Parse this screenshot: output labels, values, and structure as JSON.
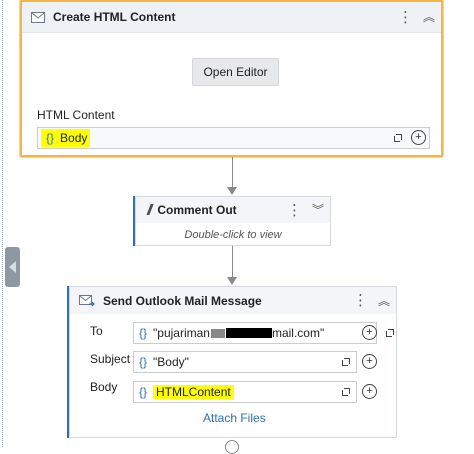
{
  "create_html": {
    "title": "Create HTML Content",
    "open_editor_label": "Open Editor",
    "html_content_label": "HTML Content",
    "html_content_value": "Body",
    "icon": "envelope-icon"
  },
  "comment_out": {
    "title": "Comment Out",
    "hint": "Double-click to view",
    "icon": "comment-slashes-icon"
  },
  "send_mail": {
    "title": "Send Outlook Mail Message",
    "icon": "send-mail-icon",
    "to_label": "To",
    "to_value_prefix": "\"pujariman",
    "to_value_suffix": "mail.com\"",
    "subject_label": "Subject",
    "subject_value": "\"Body\"",
    "body_label": "Body",
    "body_value": "HTMLContent",
    "attach_label": "Attach Files"
  },
  "colors": {
    "selected_border": "#f5b53f",
    "highlight": "#ffff00",
    "accent": "#2f6fb7",
    "connector": "#8a8a8a"
  }
}
